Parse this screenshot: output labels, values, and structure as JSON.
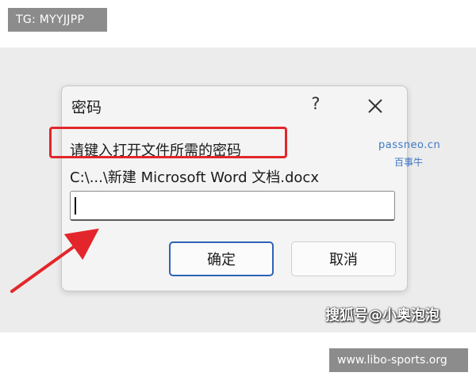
{
  "overlays": {
    "top_tag": "TG: MYYJJPP",
    "bottom_tag": "www.libo-sports.org",
    "watermark_site": "passneo.cn",
    "watermark_site_sub": "百事牛",
    "watermark_sohu": "搜狐号@小奥泡泡"
  },
  "dialog": {
    "title": "密码",
    "help_glyph": "?",
    "prompt": "请键入打开文件所需的密码",
    "file_path": "C:\\...\\新建 Microsoft Word 文档.docx",
    "password_value": "",
    "ok_label": "确定",
    "cancel_label": "取消"
  },
  "colors": {
    "highlight": "#e3262b",
    "ok_border": "#2f62b5",
    "watermark": "#3f78c4"
  },
  "icons": {
    "help": "question-mark-icon",
    "close": "close-x-icon",
    "annotation": "red-arrow-icon"
  }
}
